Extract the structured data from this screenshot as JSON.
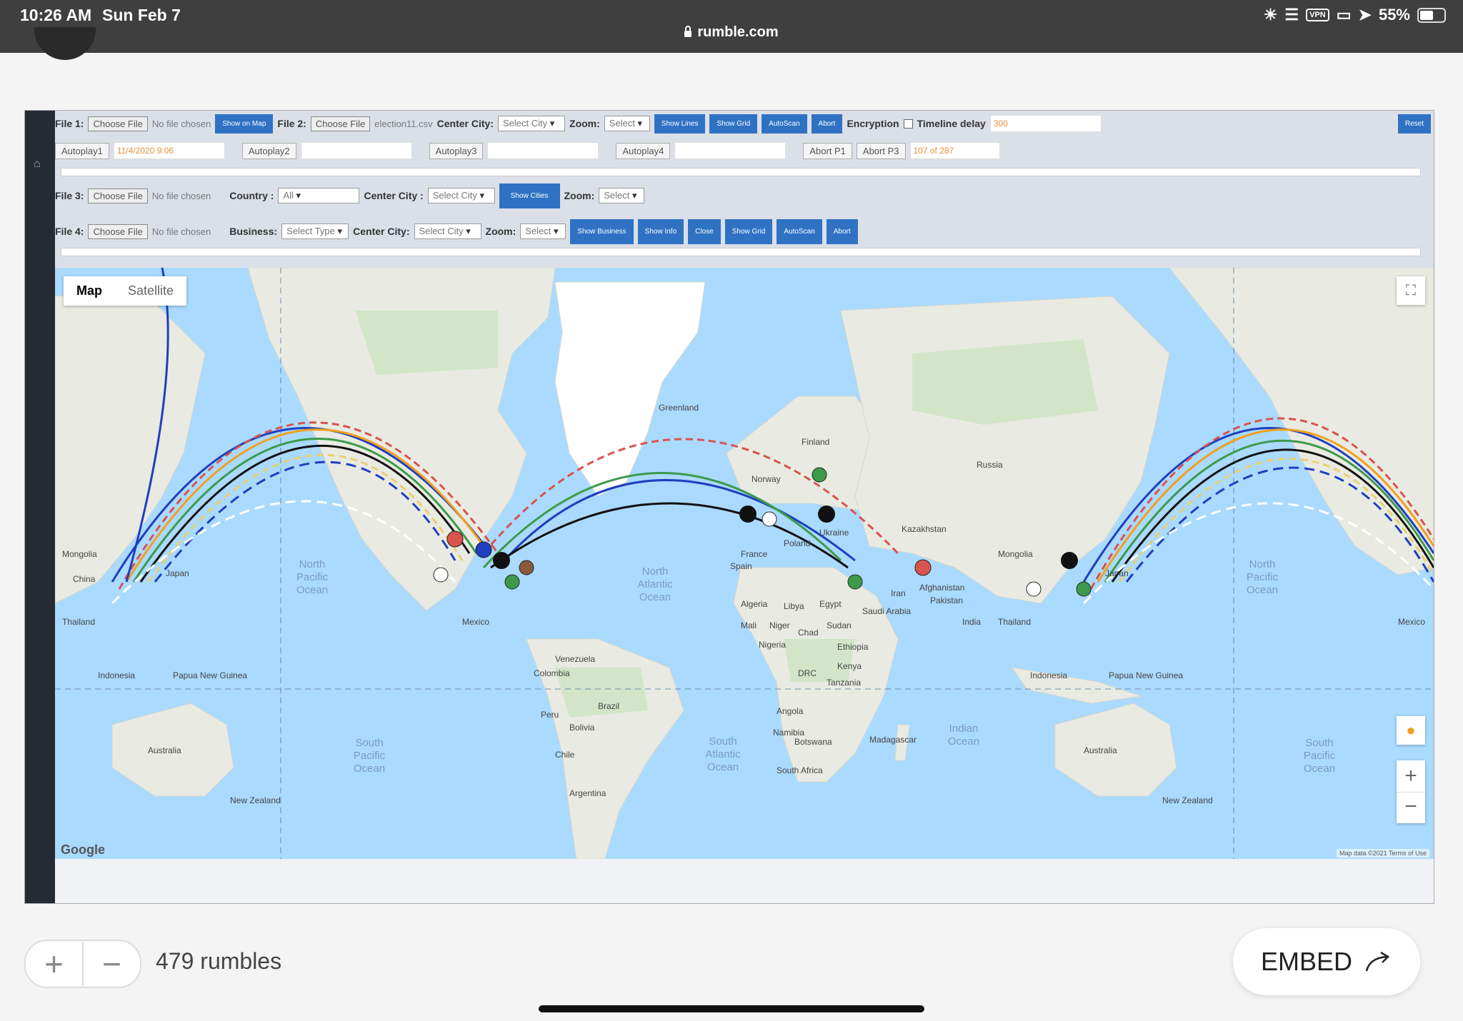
{
  "status_bar": {
    "time": "10:26 AM",
    "date": "Sun Feb 7",
    "url": "rumble.com",
    "vpn": "VPN",
    "battery": "55%",
    "battery_level": 0.55
  },
  "app": {
    "row1": {
      "file1_label": "File 1:",
      "file1_button": "Choose File",
      "file1_status": "No file chosen",
      "show_on_map": "Show on Map",
      "file2_label": "File 2:",
      "file2_button": "Choose File",
      "file2_status": "election11.csv",
      "center_city_label": "Center City:",
      "center_city_value": "Select City",
      "zoom_label": "Zoom:",
      "zoom_value": "Select",
      "show_lines": "Show Lines",
      "show_grid": "Show Grid",
      "autoscan": "AutoScan",
      "abort": "Abort",
      "encryption_label": "Encryption",
      "timeline_delay_label": "Timeline delay",
      "timeline_delay_value": "300",
      "reset": "Reset"
    },
    "row2": {
      "autoplay1": "Autoplay1",
      "autoplay1_value": "11/4/2020 9:06",
      "autoplay2": "Autoplay2",
      "autoplay3": "Autoplay3",
      "autoplay4": "Autoplay4",
      "abort_p1": "Abort P1",
      "abort_p3": "Abort P3",
      "progress": "107 of 287"
    },
    "row3": {
      "file3_label": "File 3:",
      "file3_button": "Choose File",
      "file3_status": "No file chosen",
      "country_label": "Country :",
      "country_value": "All",
      "center_city_label": "Center City :",
      "center_city_value": "Select City",
      "show_cities": "Show Cities",
      "zoom_label": "Zoom:",
      "zoom_value": "Select"
    },
    "row4": {
      "file4_label": "File 4:",
      "file4_button": "Choose File",
      "file4_status": "No file chosen",
      "business_label": "Business:",
      "business_value": "Select Type",
      "center_city_label": "Center City:",
      "center_city_value": "Select City",
      "zoom_label": "Zoom:",
      "zoom_value": "Select",
      "show_business": "Show Business",
      "show_info": "Show Info",
      "close": "Close",
      "show_grid": "Show Grid",
      "autoscan": "AutoScan",
      "abort": "Abort"
    }
  },
  "map": {
    "map_tab": "Map",
    "satellite_tab": "Satellite",
    "google": "Google",
    "map_data": "Map data ©2021   Terms of Use",
    "labels": {
      "greenland": "Greenland",
      "finland": "Finland",
      "norway": "Norway",
      "russia": "Russia",
      "kazakhstan": "Kazakhstan",
      "mongolia_l": "Mongolia",
      "mongolia_r": "Mongolia",
      "china": "China",
      "japan_l": "Japan",
      "japan_r": "Japan",
      "thailand_l": "Thailand",
      "thailand_r": "Thailand",
      "indonesia_l": "Indonesia",
      "indonesia_r": "Indonesia",
      "png_l": "Papua New Guinea",
      "png_r": "Papua New Guinea",
      "australia_l": "Australia",
      "australia_r": "Australia",
      "nz_l": "New Zealand",
      "nz_r": "New Zealand",
      "mexico_l": "Mexico",
      "mexico_r": "Mexico",
      "venezuela": "Venezuela",
      "colombia": "Colombia",
      "brazil": "Brazil",
      "peru": "Peru",
      "bolivia": "Bolivia",
      "chile": "Chile",
      "argentina": "Argentina",
      "spain": "Spain",
      "france": "France",
      "poland": "Poland",
      "ukraine": "Ukraine",
      "algeria": "Algeria",
      "libya": "Libya",
      "egypt": "Egypt",
      "mali": "Mali",
      "niger": "Niger",
      "chad": "Chad",
      "sudan": "Sudan",
      "nigeria": "Nigeria",
      "ethiopia": "Ethiopia",
      "kenya": "Kenya",
      "drc": "DRC",
      "tanzania": "Tanzania",
      "angola": "Angola",
      "namibia": "Namibia",
      "botswana": "Botswana",
      "south_africa": "South Africa",
      "madagascar": "Madagascar",
      "saudi_arabia": "Saudi Arabia",
      "iran": "Iran",
      "afghanistan": "Afghanistan",
      "pakistan": "Pakistan",
      "india": "India"
    },
    "oceans": {
      "north_pacific_l": [
        "North",
        "Pacific",
        "Ocean"
      ],
      "north_pacific_r": [
        "North",
        "Pacific",
        "Ocean"
      ],
      "north_atlantic": [
        "North",
        "Atlantic",
        "Ocean"
      ],
      "south_pacific_l": [
        "South",
        "Pacific",
        "Ocean"
      ],
      "south_pacific_r": [
        "South",
        "Pacific",
        "Ocean"
      ],
      "south_atlantic": [
        "South",
        "Atlantic",
        "Ocean"
      ],
      "indian": [
        "Indian",
        "Ocean"
      ]
    },
    "colors": {
      "water": "#aadaff",
      "land": "#e9ebe2",
      "forest": "#c7e2bd",
      "ice": "#ffffff",
      "line_blue": "#1f3fbf",
      "line_red": "#d9534f",
      "line_green": "#3c9a4a",
      "line_orange": "#f0a020",
      "line_yellow": "#e8d070",
      "line_dark": "#111111"
    }
  },
  "footer": {
    "rumbles": "479 rumbles",
    "embed": "EMBED"
  }
}
